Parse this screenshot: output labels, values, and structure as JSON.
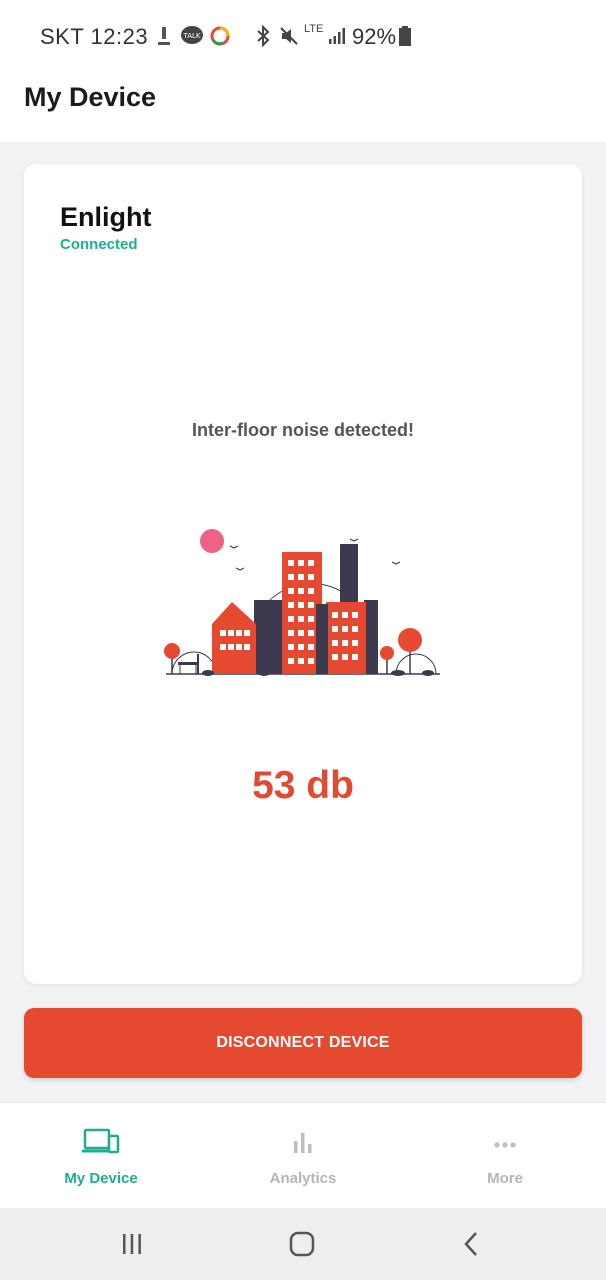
{
  "status_bar": {
    "carrier_time": "SKT 12:23",
    "network": "LTE",
    "battery": "92%",
    "icons": [
      "download-icon",
      "kakaotalk-icon",
      "chrome-icon",
      "bluetooth-icon",
      "mute-icon",
      "lte-icon",
      "signal-icon",
      "battery-icon"
    ]
  },
  "appbar": {
    "title": "My Device"
  },
  "device": {
    "name": "Enlight",
    "status": "Connected",
    "alert": "Inter-floor noise detected!",
    "reading": "53 db"
  },
  "actions": {
    "disconnect_label": "DISCONNECT DEVICE"
  },
  "tabs": [
    {
      "label": "My Device",
      "icon": "device-icon",
      "active": true
    },
    {
      "label": "Analytics",
      "icon": "bar-chart-icon",
      "active": false
    },
    {
      "label": "More",
      "icon": "more-dots-icon",
      "active": false
    }
  ],
  "nav": {
    "icons": [
      "recents-icon",
      "home-icon",
      "back-icon"
    ]
  },
  "colors": {
    "accent_green": "#1fae90",
    "accent_red": "#e54a31",
    "background": "#f1f2f4"
  }
}
